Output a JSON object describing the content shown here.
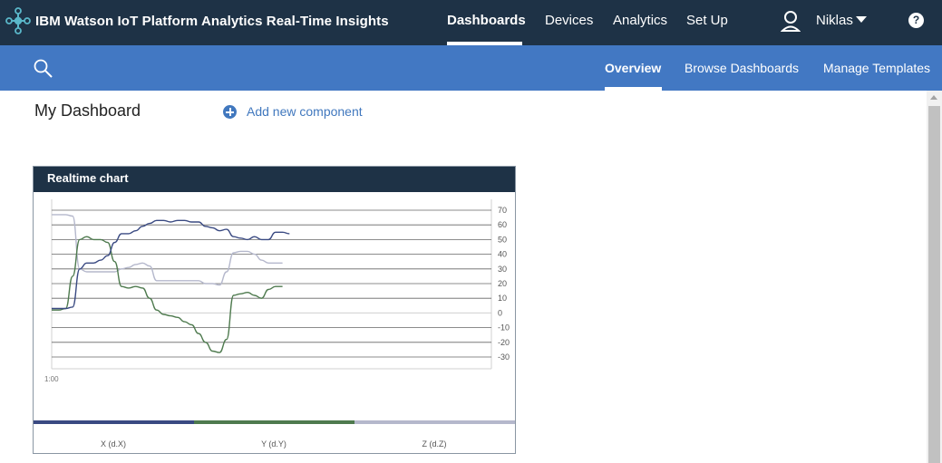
{
  "header": {
    "title": "IBM Watson IoT Platform Analytics Real-Time Insights",
    "nav": [
      {
        "label": "Dashboards",
        "active": true
      },
      {
        "label": "Devices",
        "active": false
      },
      {
        "label": "Analytics",
        "active": false
      },
      {
        "label": "Set Up",
        "active": false
      }
    ],
    "user_name": "Niklas",
    "help_label": "?"
  },
  "subheader": {
    "search_icon": "search-icon",
    "tabs": [
      {
        "label": "Overview",
        "active": true
      },
      {
        "label": "Browse Dashboards",
        "active": false
      },
      {
        "label": "Manage Templates",
        "active": false
      }
    ]
  },
  "page": {
    "title": "My Dashboard",
    "add_component_label": "Add new component"
  },
  "card": {
    "title": "Realtime chart"
  },
  "chart_data": {
    "type": "line",
    "title": "Realtime chart",
    "xlabel": "",
    "ylabel": "",
    "x_tick_labels": [
      "1:00"
    ],
    "y_ticks": [
      70,
      60,
      50,
      40,
      30,
      20,
      10,
      0,
      -10,
      -20,
      -30
    ],
    "ylim": [
      -35,
      75
    ],
    "grid": true,
    "legend_position": "bottom",
    "x": [
      0,
      1,
      2,
      3,
      4,
      5,
      6,
      7,
      8,
      9,
      10,
      11,
      12,
      13,
      14,
      15,
      16,
      17,
      18,
      19,
      20,
      21,
      22,
      23,
      24,
      25,
      26,
      27,
      28,
      29,
      30,
      31,
      32,
      33,
      34,
      35
    ],
    "series": [
      {
        "name": "X (d.X)",
        "color": "#3a4a82",
        "values": [
          3,
          3,
          3,
          4,
          30,
          34,
          34,
          36,
          39,
          48,
          54,
          54,
          56,
          59,
          61,
          63,
          63,
          62,
          63,
          63,
          62,
          62,
          59,
          58,
          56,
          57,
          52,
          51,
          50,
          52,
          50,
          50,
          55,
          55,
          54,
          null
        ]
      },
      {
        "name": "Y (d.Y)",
        "color": "#4e7a4e",
        "values": [
          2,
          2,
          3,
          25,
          50,
          52,
          50,
          50,
          48,
          35,
          18,
          17,
          18,
          17,
          10,
          2,
          -1,
          -2,
          -3,
          -6,
          -8,
          -14,
          -20,
          -26,
          -27,
          -18,
          12,
          13,
          14,
          12,
          10,
          16,
          18,
          18,
          null,
          null
        ]
      },
      {
        "name": "Z (d.Z)",
        "color": "#b5b8cc",
        "values": [
          67,
          67,
          67,
          66,
          30,
          28,
          28,
          28,
          28,
          28,
          30,
          31,
          33,
          34,
          32,
          22,
          22,
          22,
          22,
          22,
          22,
          22,
          20,
          20,
          19,
          28,
          41,
          42,
          42,
          40,
          36,
          34,
          34,
          34,
          null,
          null
        ]
      }
    ]
  }
}
